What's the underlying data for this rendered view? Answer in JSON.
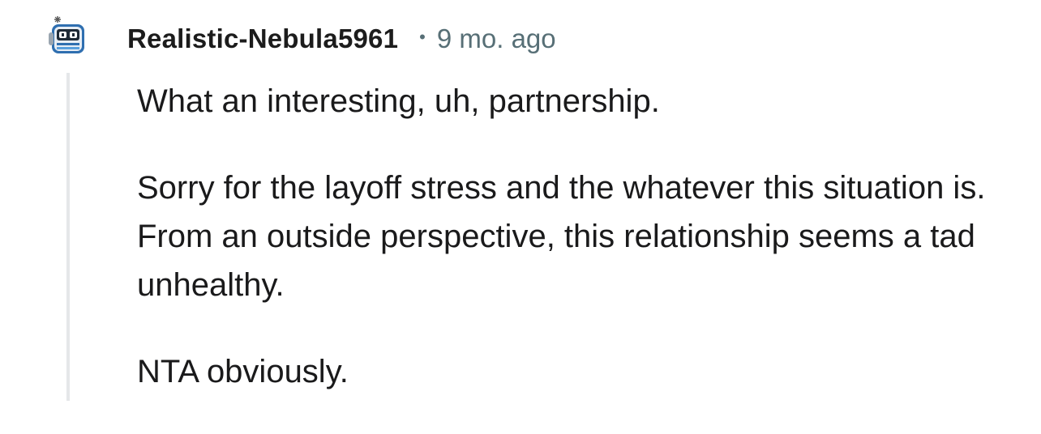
{
  "comment": {
    "author": "Realistic-Nebula5961",
    "separator": "•",
    "timestamp": "9 mo. ago",
    "avatar_icon": "snoo-avatar-icon",
    "paragraphs": [
      "What an interesting, uh, partnership.",
      "Sorry for the layoff stress and the whatever this situation is. From an outside perspective, this relationship seems a tad unhealthy.",
      "NTA obviously."
    ]
  },
  "colors": {
    "text": "#1a1a1b",
    "meta": "#576f76",
    "thread_line": "#e5e7e9",
    "avatar_blue": "#2f6fb0"
  }
}
